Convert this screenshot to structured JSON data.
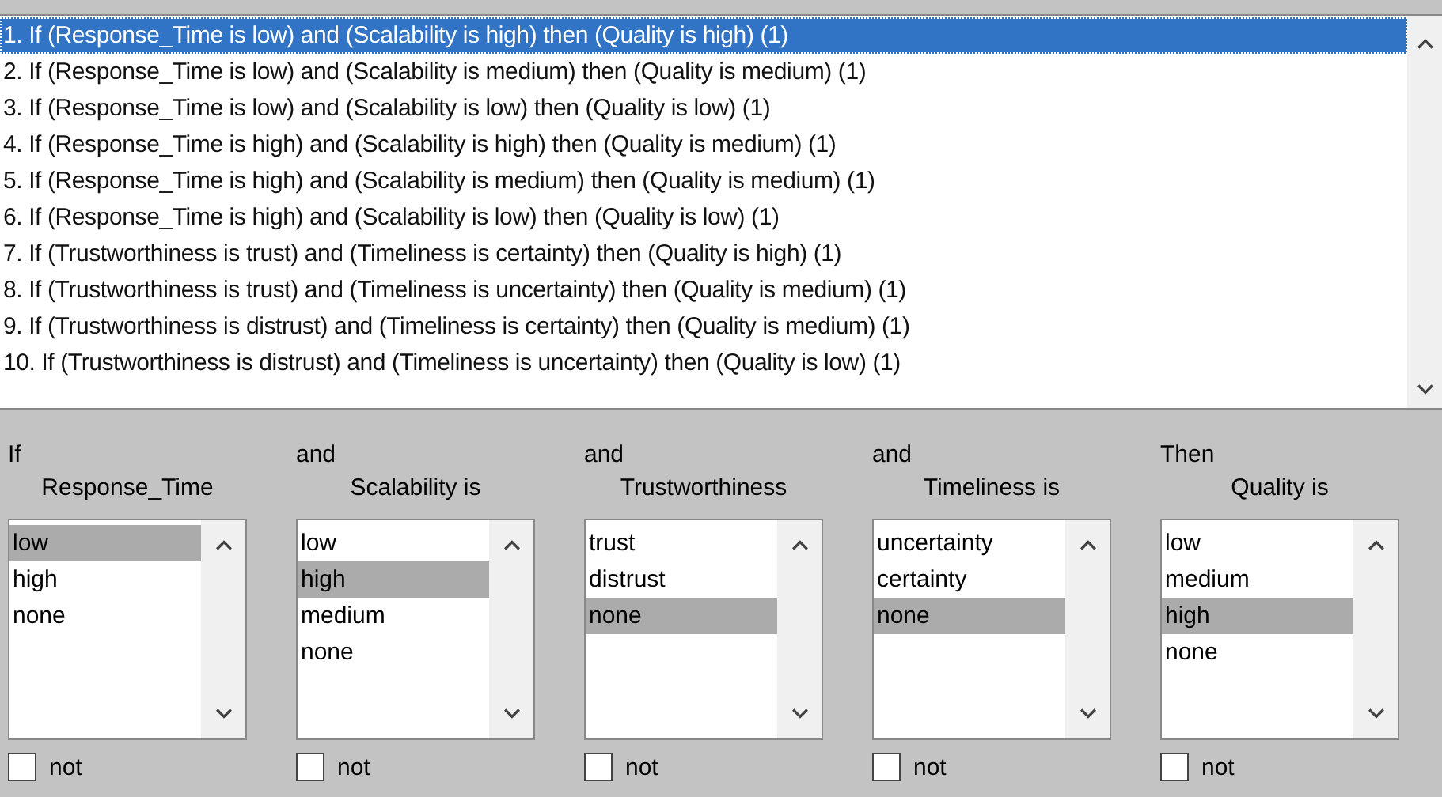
{
  "rules": [
    {
      "text": "1. If (Response_Time is low) and (Scalability is high) then (Quality is high) (1)",
      "selected": true
    },
    {
      "text": "2. If (Response_Time is low) and (Scalability is medium) then (Quality is medium) (1)",
      "selected": false
    },
    {
      "text": "3. If (Response_Time is low) and (Scalability is low) then (Quality is low) (1)",
      "selected": false
    },
    {
      "text": "4. If (Response_Time is high) and (Scalability is high) then (Quality is medium) (1)",
      "selected": false
    },
    {
      "text": "5. If (Response_Time is high) and (Scalability is medium) then (Quality is medium) (1)",
      "selected": false
    },
    {
      "text": "6. If (Response_Time is high) and (Scalability is low) then (Quality is low) (1)",
      "selected": false
    },
    {
      "text": "7. If (Trustworthiness is trust) and (Timeliness is certainty) then (Quality is high) (1)",
      "selected": false
    },
    {
      "text": "8. If (Trustworthiness is trust) and (Timeliness is uncertainty) then (Quality is medium) (1)",
      "selected": false
    },
    {
      "text": "9. If (Trustworthiness is distrust) and (Timeliness is certainty) then (Quality is medium) (1)",
      "selected": false
    },
    {
      "text": "10. If (Trustworthiness is distrust) and (Timeliness is uncertainty) then (Quality is low) (1)",
      "selected": false
    }
  ],
  "variables": [
    {
      "connector": "If",
      "name": "Response_Time",
      "options": [
        {
          "label": "low",
          "selected": true
        },
        {
          "label": "high",
          "selected": false
        },
        {
          "label": "none",
          "selected": false
        }
      ],
      "not_label": "not",
      "not_checked": false
    },
    {
      "connector": "and",
      "name": "Scalability is",
      "options": [
        {
          "label": "low",
          "selected": false
        },
        {
          "label": "high",
          "selected": true
        },
        {
          "label": "medium",
          "selected": false
        },
        {
          "label": "none",
          "selected": false
        }
      ],
      "not_label": "not",
      "not_checked": false
    },
    {
      "connector": "and",
      "name": "Trustworthiness",
      "options": [
        {
          "label": "trust",
          "selected": false
        },
        {
          "label": "distrust",
          "selected": false
        },
        {
          "label": "none",
          "selected": true
        }
      ],
      "not_label": "not",
      "not_checked": false
    },
    {
      "connector": "and",
      "name": "Timeliness is",
      "options": [
        {
          "label": "uncertainty",
          "selected": false
        },
        {
          "label": "certainty",
          "selected": false
        },
        {
          "label": "none",
          "selected": true
        }
      ],
      "not_label": "not",
      "not_checked": false
    },
    {
      "connector": "Then",
      "name": "Quality is",
      "options": [
        {
          "label": "low",
          "selected": false
        },
        {
          "label": "medium",
          "selected": false
        },
        {
          "label": "high",
          "selected": true
        },
        {
          "label": "none",
          "selected": false
        }
      ],
      "not_label": "not",
      "not_checked": false
    }
  ]
}
